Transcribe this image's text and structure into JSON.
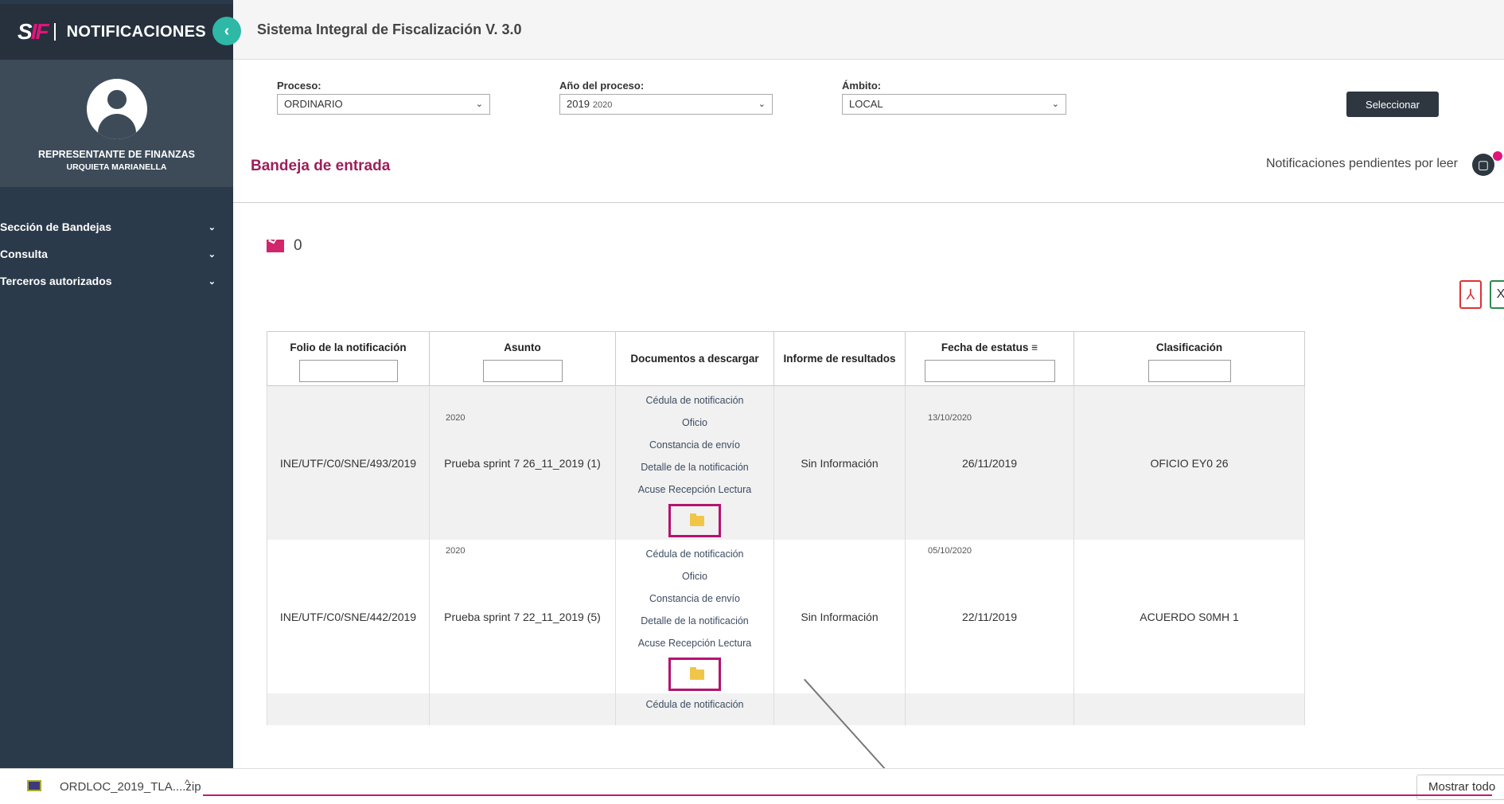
{
  "app": {
    "brand_title": "NOTIFICACIONES",
    "logo_s": "S",
    "logo_f": "IF",
    "window_title": "Sistema Integral de Fiscalización V. 3.0"
  },
  "user": {
    "role": "REPRESENTANTE DE FINANZAS",
    "name": "URQUIETA MARIANELLA"
  },
  "menu": [
    {
      "label": "Sección de Bandejas"
    },
    {
      "label": "Consulta"
    },
    {
      "label": "Terceros autorizados"
    }
  ],
  "filters": {
    "proceso": {
      "label": "Proceso:",
      "value": "ORDINARIO"
    },
    "anio": {
      "label": "Año del proceso:",
      "value": "2019",
      "sub": "2020"
    },
    "ambito": {
      "label": "Ámbito:",
      "value": "LOCAL"
    },
    "submit": "Seleccionar"
  },
  "inbox": {
    "title": "Bandeja de entrada",
    "pending": "Notificaciones pendientes por leer",
    "count": "0"
  },
  "export": {
    "pdf_icon": "pdf-icon",
    "xls_label": "X"
  },
  "table": {
    "headers": [
      "Folio de la notificación",
      "Asunto",
      "Documentos a descargar",
      "Informe de resultados",
      "Fecha de estatus",
      "Clasificación"
    ],
    "documents": [
      "Cédula de notificación",
      "Oficio",
      "Constancia de envío",
      "Detalle de la notificación",
      "Acuse Recepción Lectura"
    ],
    "rows": [
      {
        "folio": "INE/UTF/C0/SNE/493/2019",
        "asunto": "Prueba sprint 7 26_11_2019 (1)",
        "asunto_year": "2020",
        "informe": "Sin Información",
        "fecha_small": "13/10/2020",
        "fecha": "26/11/2019",
        "clasificacion": "OFICIO EY0 26"
      },
      {
        "folio": "INE/UTF/C0/SNE/442/2019",
        "asunto": "Prueba sprint 7 22_11_2019 (5)",
        "asunto_year": "2020",
        "informe": "Sin Información",
        "fecha_small": "05/10/2020",
        "fecha": "22/11/2019",
        "clasificacion": "ACUERDO S0MH 1"
      },
      {
        "doc_first": "Cédula de notificación"
      }
    ]
  },
  "download": {
    "filename": "ORDLOC_2019_TLA....zip",
    "show_all": "Mostrar todo"
  }
}
